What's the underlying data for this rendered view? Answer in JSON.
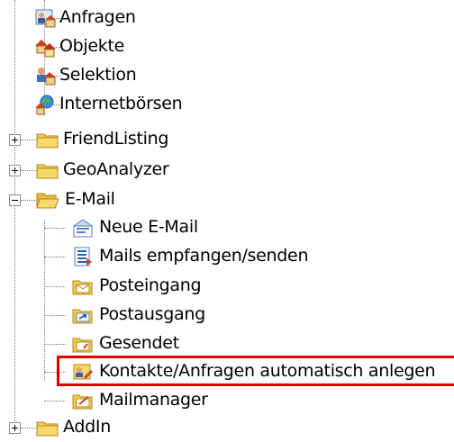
{
  "tree": {
    "items": [
      {
        "label": "Anfragen",
        "icon": "user-house-icon"
      },
      {
        "label": "Objekte",
        "icon": "houses-icon"
      },
      {
        "label": "Selektion",
        "icon": "selection-house-icon"
      },
      {
        "label": "Internetbörsen",
        "icon": "globe-house-icon"
      },
      {
        "label": "FriendListing",
        "icon": "folder-icon",
        "expander": "+"
      },
      {
        "label": "GeoAnalyzer",
        "icon": "folder-icon",
        "expander": "+"
      },
      {
        "label": "E-Mail",
        "icon": "folder-open-icon",
        "expander": "-"
      },
      {
        "label": "Neue E-Mail",
        "icon": "new-mail-icon"
      },
      {
        "label": "Mails empfangen/senden",
        "icon": "send-receive-icon"
      },
      {
        "label": "Posteingang",
        "icon": "inbox-icon"
      },
      {
        "label": "Postausgang",
        "icon": "outbox-icon"
      },
      {
        "label": "Gesendet",
        "icon": "sent-icon"
      },
      {
        "label": "Kontakte/Anfragen automatisch anlegen",
        "icon": "contacts-auto-icon",
        "highlighted": true
      },
      {
        "label": "Mailmanager",
        "icon": "mailmanager-icon"
      },
      {
        "label": "AddIn",
        "icon": "folder-icon",
        "expander": "+"
      }
    ]
  },
  "colors": {
    "highlight": "#e00000",
    "folder": "#f3c94c"
  }
}
